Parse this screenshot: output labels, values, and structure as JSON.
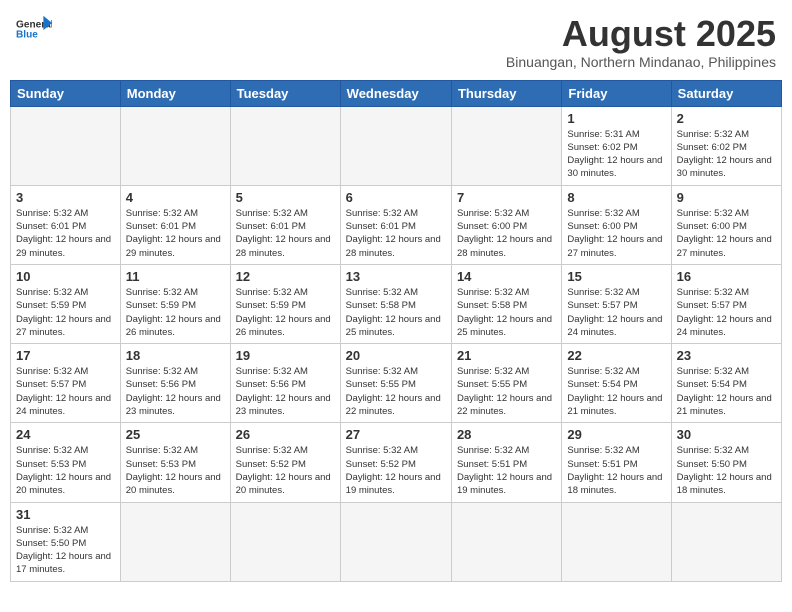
{
  "header": {
    "logo": {
      "general": "General",
      "blue": "Blue"
    },
    "title": "August 2025",
    "subtitle": "Binuangan, Northern Mindanao, Philippines"
  },
  "days_of_week": [
    "Sunday",
    "Monday",
    "Tuesday",
    "Wednesday",
    "Thursday",
    "Friday",
    "Saturday"
  ],
  "weeks": [
    [
      {
        "day": "",
        "info": ""
      },
      {
        "day": "",
        "info": ""
      },
      {
        "day": "",
        "info": ""
      },
      {
        "day": "",
        "info": ""
      },
      {
        "day": "",
        "info": ""
      },
      {
        "day": "1",
        "info": "Sunrise: 5:31 AM\nSunset: 6:02 PM\nDaylight: 12 hours and 30 minutes."
      },
      {
        "day": "2",
        "info": "Sunrise: 5:32 AM\nSunset: 6:02 PM\nDaylight: 12 hours and 30 minutes."
      }
    ],
    [
      {
        "day": "3",
        "info": "Sunrise: 5:32 AM\nSunset: 6:01 PM\nDaylight: 12 hours and 29 minutes."
      },
      {
        "day": "4",
        "info": "Sunrise: 5:32 AM\nSunset: 6:01 PM\nDaylight: 12 hours and 29 minutes."
      },
      {
        "day": "5",
        "info": "Sunrise: 5:32 AM\nSunset: 6:01 PM\nDaylight: 12 hours and 28 minutes."
      },
      {
        "day": "6",
        "info": "Sunrise: 5:32 AM\nSunset: 6:01 PM\nDaylight: 12 hours and 28 minutes."
      },
      {
        "day": "7",
        "info": "Sunrise: 5:32 AM\nSunset: 6:00 PM\nDaylight: 12 hours and 28 minutes."
      },
      {
        "day": "8",
        "info": "Sunrise: 5:32 AM\nSunset: 6:00 PM\nDaylight: 12 hours and 27 minutes."
      },
      {
        "day": "9",
        "info": "Sunrise: 5:32 AM\nSunset: 6:00 PM\nDaylight: 12 hours and 27 minutes."
      }
    ],
    [
      {
        "day": "10",
        "info": "Sunrise: 5:32 AM\nSunset: 5:59 PM\nDaylight: 12 hours and 27 minutes."
      },
      {
        "day": "11",
        "info": "Sunrise: 5:32 AM\nSunset: 5:59 PM\nDaylight: 12 hours and 26 minutes."
      },
      {
        "day": "12",
        "info": "Sunrise: 5:32 AM\nSunset: 5:59 PM\nDaylight: 12 hours and 26 minutes."
      },
      {
        "day": "13",
        "info": "Sunrise: 5:32 AM\nSunset: 5:58 PM\nDaylight: 12 hours and 25 minutes."
      },
      {
        "day": "14",
        "info": "Sunrise: 5:32 AM\nSunset: 5:58 PM\nDaylight: 12 hours and 25 minutes."
      },
      {
        "day": "15",
        "info": "Sunrise: 5:32 AM\nSunset: 5:57 PM\nDaylight: 12 hours and 24 minutes."
      },
      {
        "day": "16",
        "info": "Sunrise: 5:32 AM\nSunset: 5:57 PM\nDaylight: 12 hours and 24 minutes."
      }
    ],
    [
      {
        "day": "17",
        "info": "Sunrise: 5:32 AM\nSunset: 5:57 PM\nDaylight: 12 hours and 24 minutes."
      },
      {
        "day": "18",
        "info": "Sunrise: 5:32 AM\nSunset: 5:56 PM\nDaylight: 12 hours and 23 minutes."
      },
      {
        "day": "19",
        "info": "Sunrise: 5:32 AM\nSunset: 5:56 PM\nDaylight: 12 hours and 23 minutes."
      },
      {
        "day": "20",
        "info": "Sunrise: 5:32 AM\nSunset: 5:55 PM\nDaylight: 12 hours and 22 minutes."
      },
      {
        "day": "21",
        "info": "Sunrise: 5:32 AM\nSunset: 5:55 PM\nDaylight: 12 hours and 22 minutes."
      },
      {
        "day": "22",
        "info": "Sunrise: 5:32 AM\nSunset: 5:54 PM\nDaylight: 12 hours and 21 minutes."
      },
      {
        "day": "23",
        "info": "Sunrise: 5:32 AM\nSunset: 5:54 PM\nDaylight: 12 hours and 21 minutes."
      }
    ],
    [
      {
        "day": "24",
        "info": "Sunrise: 5:32 AM\nSunset: 5:53 PM\nDaylight: 12 hours and 20 minutes."
      },
      {
        "day": "25",
        "info": "Sunrise: 5:32 AM\nSunset: 5:53 PM\nDaylight: 12 hours and 20 minutes."
      },
      {
        "day": "26",
        "info": "Sunrise: 5:32 AM\nSunset: 5:52 PM\nDaylight: 12 hours and 20 minutes."
      },
      {
        "day": "27",
        "info": "Sunrise: 5:32 AM\nSunset: 5:52 PM\nDaylight: 12 hours and 19 minutes."
      },
      {
        "day": "28",
        "info": "Sunrise: 5:32 AM\nSunset: 5:51 PM\nDaylight: 12 hours and 19 minutes."
      },
      {
        "day": "29",
        "info": "Sunrise: 5:32 AM\nSunset: 5:51 PM\nDaylight: 12 hours and 18 minutes."
      },
      {
        "day": "30",
        "info": "Sunrise: 5:32 AM\nSunset: 5:50 PM\nDaylight: 12 hours and 18 minutes."
      }
    ],
    [
      {
        "day": "31",
        "info": "Sunrise: 5:32 AM\nSunset: 5:50 PM\nDaylight: 12 hours and 17 minutes."
      },
      {
        "day": "",
        "info": ""
      },
      {
        "day": "",
        "info": ""
      },
      {
        "day": "",
        "info": ""
      },
      {
        "day": "",
        "info": ""
      },
      {
        "day": "",
        "info": ""
      },
      {
        "day": "",
        "info": ""
      }
    ]
  ]
}
